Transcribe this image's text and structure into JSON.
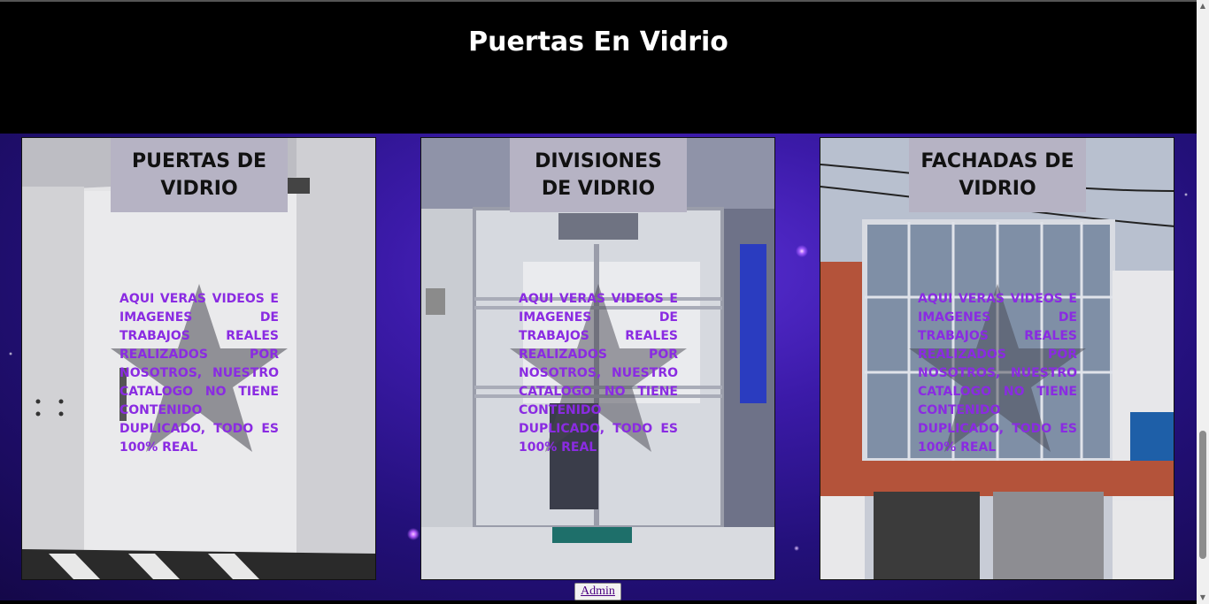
{
  "header": {
    "title": "Puertas En Vidrio"
  },
  "cards": [
    {
      "heading": "PUERTAS DE VIDRIO",
      "description": "AQUI VERAS VIDEOS E IMAGENES DE TRABAJOS REALES REALIZADOS POR NOSOTROS, NUESTRO CATALOGO NO TIENE CONTENIDO DUPLICADO, TODO ES 100% REAL"
    },
    {
      "heading": "DIVISIONES DE VIDRIO",
      "description": "AQUI VERAS VIDEOS E IMAGENES DE TRABAJOS REALES REALIZADOS POR NOSOTROS, NUESTRO CATALOGO NO TIENE CONTENIDO DUPLICADO, TODO ES 100% REAL"
    },
    {
      "heading": "FACHADAS DE VIDRIO",
      "description": "AQUI VERAS VIDEOS E IMAGENES DE TRABAJOS REALES REALIZADOS POR NOSOTROS, NUESTRO CATALOGO NO TIENE CONTENIDO DUPLICADO, TODO ES 100% REAL"
    }
  ],
  "footer": {
    "admin_label": "Admin"
  },
  "colors": {
    "header_bg": "#000000",
    "heading_box": "#b6b3c4",
    "description_text": "#8a2be2",
    "background": "#3b1aa8"
  },
  "icons": {
    "card_overlay": "star-icon"
  }
}
